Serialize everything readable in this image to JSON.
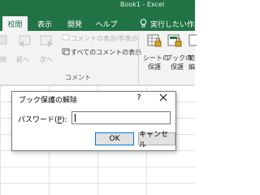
{
  "window": {
    "title": "Book1 - Excel"
  },
  "tabs": [
    {
      "label": "校閲",
      "active": true
    },
    {
      "label": "表示",
      "active": false
    },
    {
      "label": "開発",
      "active": false
    },
    {
      "label": "ヘルプ",
      "active": false
    }
  ],
  "tell_me": {
    "placeholder": "実行したい作業を入"
  },
  "ribbon": {
    "delete_label": "除",
    "prev_label": "前へ",
    "next_label": "次へ",
    "show_hide_comment": "コメントの表示/非表示",
    "show_all_comments": "すべてのコメントの表示",
    "group_comment": "コメント",
    "protect_sheet_line1": "シートの",
    "protect_sheet_line2": "保護",
    "protect_book_line1": "ブックの",
    "protect_book_line2": "保護",
    "protect_more_line1": "範",
    "protect_more_line2": "編"
  },
  "dialog": {
    "title": "ブック保護の解除",
    "help": "?",
    "password_label_pre": "パスワード(",
    "password_label_key": "P",
    "password_label_post": "):",
    "password_value": "",
    "ok_label": "OK",
    "cancel_label": "キャンセル"
  },
  "colors": {
    "excel_green": "#217346",
    "ok_border": "#0078d7"
  }
}
